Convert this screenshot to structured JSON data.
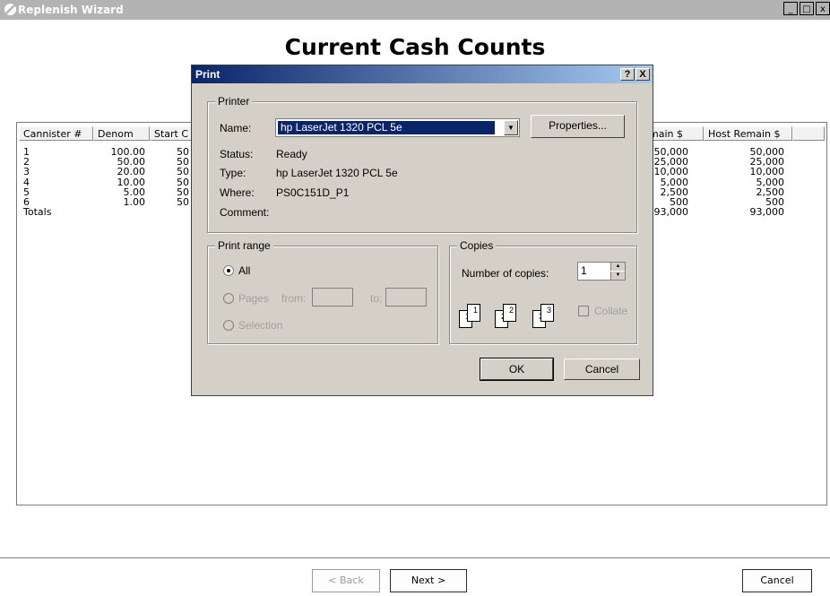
{
  "window": {
    "title": "Replenish Wizard",
    "min_glyph": "_",
    "max_glyph": "□",
    "close_glyph": "x"
  },
  "page_title": "Current Cash Counts",
  "table": {
    "headers": [
      "Cannister #",
      "Denom",
      "Start C",
      "main $",
      "Host Remain $"
    ],
    "rows": [
      {
        "cannister": "1",
        "denom": "100.00",
        "start": "50",
        "remain": "50,000",
        "host": "50,000"
      },
      {
        "cannister": "2",
        "denom": "50.00",
        "start": "50",
        "remain": "25,000",
        "host": "25,000"
      },
      {
        "cannister": "3",
        "denom": "20.00",
        "start": "50",
        "remain": "10,000",
        "host": "10,000"
      },
      {
        "cannister": "4",
        "denom": "10.00",
        "start": "50",
        "remain": "5,000",
        "host": "5,000"
      },
      {
        "cannister": "5",
        "denom": "5.00",
        "start": "50",
        "remain": "2,500",
        "host": "2,500"
      },
      {
        "cannister": "6",
        "denom": "1.00",
        "start": "50",
        "remain": "500",
        "host": "500"
      }
    ],
    "totals": {
      "label": "Totals",
      "remain": "93,000",
      "host": "93,000"
    }
  },
  "nav": {
    "back": "< Back",
    "next": "Next >",
    "cancel": "Cancel"
  },
  "print_dialog": {
    "title": "Print",
    "help_glyph": "?",
    "close_glyph": "X",
    "printer": {
      "legend": "Printer",
      "name_label": "Name:",
      "name_value": "hp LaserJet 1320 PCL 5e",
      "properties_button": "Properties...",
      "status_label": "Status:",
      "status_value": "Ready",
      "type_label": "Type:",
      "type_value": "hp LaserJet 1320 PCL 5e",
      "where_label": "Where:",
      "where_value": "PS0C151D_P1",
      "comment_label": "Comment:"
    },
    "print_range": {
      "legend": "Print range",
      "all": "All",
      "pages": "Pages",
      "from": "from:",
      "to": "to:",
      "selection": "Selection"
    },
    "copies": {
      "legend": "Copies",
      "number_label": "Number of copies:",
      "number_value": "1",
      "collate": "Collate",
      "page_digits": [
        "1",
        "1",
        "2",
        "2",
        "3",
        "3"
      ]
    },
    "ok": "OK",
    "cancel": "Cancel"
  }
}
